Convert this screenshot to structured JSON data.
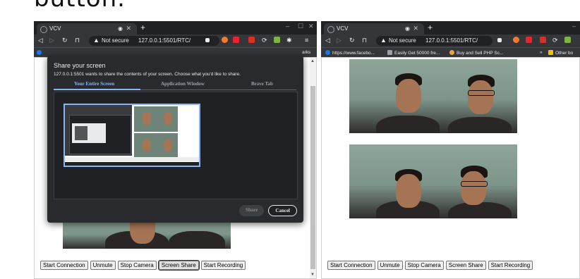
{
  "caption": "button.",
  "left_window": {
    "tab_title": "VCV",
    "new_tab": "+",
    "url_warning": "Not secure",
    "url": "127.0.0.1:5501/RTC/",
    "bookmarks_overflow": "arks",
    "dialog": {
      "title": "Share your screen",
      "description": "127.0.0.1:5501 wants to share the contents of your screen. Choose what you'd like to share.",
      "tabs": [
        "Your Entire Screen",
        "Application Window",
        "Brave Tab"
      ],
      "active_tab": "Your Entire Screen",
      "share_label": "Share",
      "cancel_label": "Cancel"
    },
    "buttons": [
      "Start Connection",
      "Unmute",
      "Stop Camera",
      "Screen Share",
      "Start Recording"
    ]
  },
  "right_window": {
    "tab_title": "VCV",
    "new_tab": "+",
    "url_warning": "Not secure",
    "url": "127.0.0.1:5501/RTC/",
    "bookmarks": [
      "https://www.facebo...",
      "Easily Get 50000 fre...",
      "Buy and Sell PHP Sc...",
      "Other bo"
    ],
    "buttons": [
      "Start Connection",
      "Unmute",
      "Stop Camera",
      "Screen Share",
      "Start Recording"
    ]
  },
  "colors": {
    "chrome_dark": "#202124",
    "chrome_toolbar": "#35363a",
    "accent_blue": "#8ab4f8",
    "dialog_bg": "#292a2d"
  }
}
